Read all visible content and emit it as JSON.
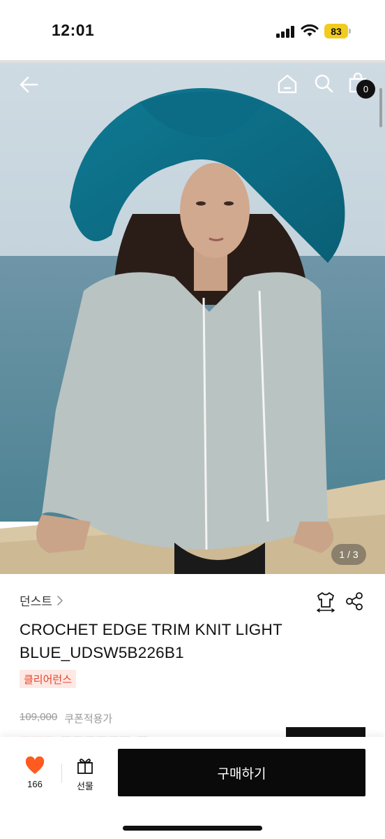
{
  "status_bar": {
    "time": "12:01",
    "battery_level": "83",
    "battery_color": "#f2cb1e"
  },
  "top_nav": {
    "icons": [
      "back-arrow-icon",
      "home-icon",
      "search-icon",
      "shopping-bag-icon"
    ],
    "cart_count": "0"
  },
  "gallery": {
    "counter": "1 / 3"
  },
  "product": {
    "brand": "던스트",
    "title_line1": "CROCHET EDGE TRIM KNIT LIGHT",
    "title_line2": "BLUE_UDSW5B226B1",
    "tag": "클리어런스",
    "original_price": "109,000",
    "coupon_note": "쿠폰적용가",
    "icons": [
      "size-guide-shirt-icon",
      "share-icon"
    ]
  },
  "bottom_bar": {
    "like_count": "166",
    "gift_label": "선물",
    "buy_label": "구매하기"
  },
  "colors": {
    "accent": "#ff5a1f",
    "tag_text": "#e6432b",
    "tag_bg": "#fde8e4",
    "buy_button": "#0a0a0a"
  }
}
